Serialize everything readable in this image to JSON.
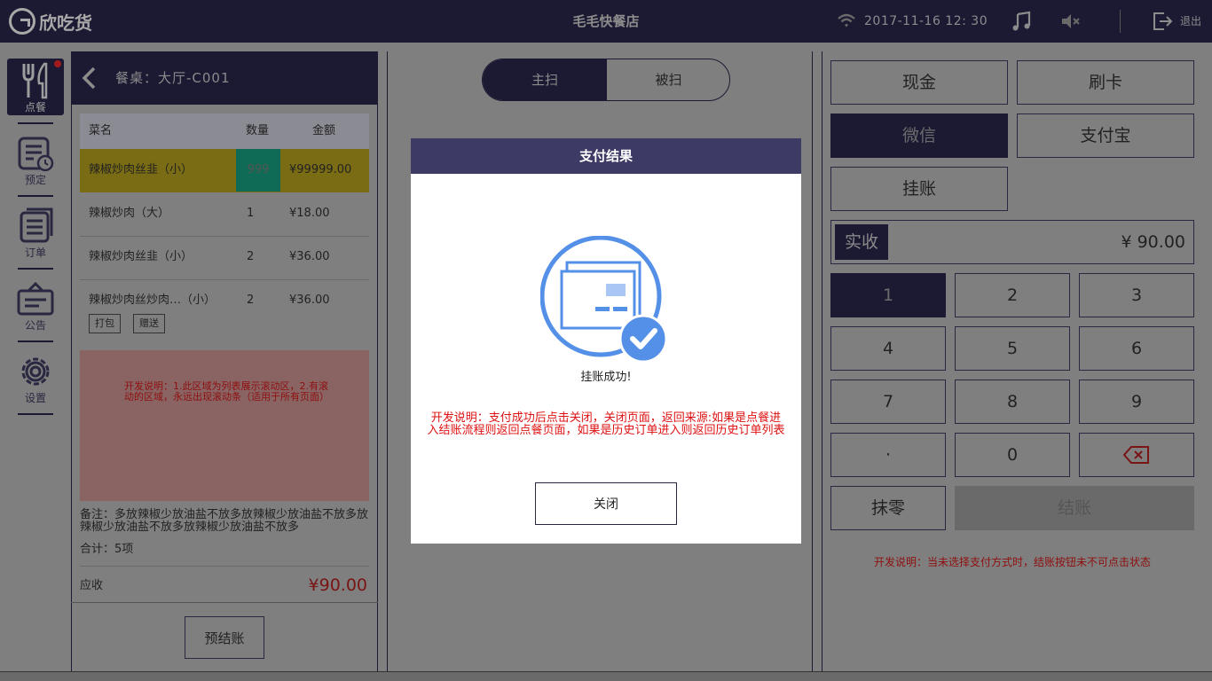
{
  "topbar": {
    "brand": "欣吃货",
    "store_name": "毛毛快餐店",
    "datetime": "2017-11-16  12: 30",
    "exit_label": "退出"
  },
  "rail": {
    "items": [
      {
        "label": "点餐",
        "icon": "fork-knife-icon",
        "active": true
      },
      {
        "label": "预定",
        "icon": "calendar-clock-icon"
      },
      {
        "label": "订单",
        "icon": "orders-icon"
      },
      {
        "label": "公告",
        "icon": "notice-icon"
      },
      {
        "label": "设置",
        "icon": "gear-icon"
      }
    ]
  },
  "order": {
    "table_label": "餐桌：大厅-C001",
    "columns": [
      "菜名",
      "数量",
      "金额"
    ],
    "rows": [
      {
        "name": "辣椒炒肉丝韭（小）",
        "qty": "999",
        "amount": "¥99999.00"
      },
      {
        "name": "辣椒炒肉（大）",
        "qty": "1",
        "amount": "¥18.00"
      },
      {
        "name": "辣椒炒肉丝韭（小）",
        "qty": "2",
        "amount": "¥36.00"
      },
      {
        "name": "辣椒炒肉丝炒肉…（小）",
        "qty": "2",
        "amount": "¥36.00"
      }
    ],
    "tags": [
      "打包",
      "赠送"
    ],
    "dev_note": "开发说明：1.此区域为列表展示滚动区，2.有滚动的区域，永远出现滚动条（适用于所有页面）",
    "remark": "备注：多放辣椒少放油盐不放多放辣椒少放油盐不放多放辣椒少放油盐不放多放辣椒少放油盐不放多",
    "total_count": "合计：5项",
    "due_label": "应收",
    "due_value": "¥90.00",
    "prebill_label": "预结账"
  },
  "scan": {
    "active_tab": "主扫",
    "other_tab": "被扫"
  },
  "payment": {
    "methods": [
      "现金",
      "刷卡",
      "微信",
      "支付宝",
      "挂账"
    ],
    "selected_method": "微信",
    "paid_label": "实收",
    "paid_value": "¥ 90.00",
    "keys": [
      "1",
      "2",
      "3",
      "4",
      "5",
      "6",
      "7",
      "8",
      "9",
      "·",
      "0"
    ],
    "backspace_icon": "backspace-icon",
    "round_label": "抹零",
    "checkout_label": "结账",
    "dev_note": "开发说明：当未选择支付方式时，结账按钮未不可点击状态"
  },
  "modal": {
    "title": "支付结果",
    "icon": "payment-success-icon",
    "message": "挂账成功!",
    "dev_note": "开发说明：支付成功后点击关闭，关闭页面，返回来源:如果是点餐进入结账流程则返回点餐页面，如果是历史订单进入则返回历史订单列表",
    "close_label": "关闭"
  },
  "colors": {
    "navy": "#1c1a33",
    "modal_header": "#3d3a66",
    "accent_blue": "#5590e8",
    "note_red": "#dd1111"
  }
}
